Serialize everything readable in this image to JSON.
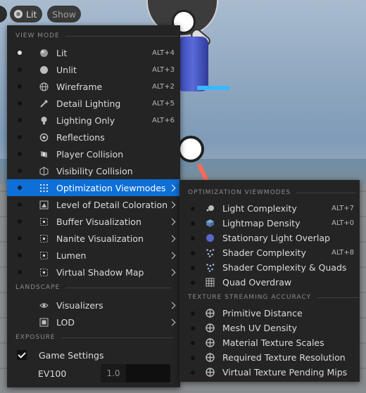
{
  "toolbar": {
    "lit_label": "Lit",
    "show_label": "Show"
  },
  "main_menu": {
    "sections": {
      "view_mode": "VIEW MODE",
      "landscape": "LANDSCAPE",
      "exposure": "EXPOSURE"
    },
    "items": [
      {
        "label": "Lit",
        "shortcut": "ALT+4",
        "icon": "lit-sphere-icon",
        "selected": true
      },
      {
        "label": "Unlit",
        "shortcut": "ALT+3",
        "icon": "unlit-sphere-icon"
      },
      {
        "label": "Wireframe",
        "shortcut": "ALT+2",
        "icon": "wireframe-globe-icon"
      },
      {
        "label": "Detail Lighting",
        "shortcut": "ALT+5",
        "icon": "detail-lighting-icon"
      },
      {
        "label": "Lighting Only",
        "shortcut": "ALT+6",
        "icon": "light-bulb-icon"
      },
      {
        "label": "Reflections",
        "shortcut": "",
        "icon": "reflection-sphere-icon"
      },
      {
        "label": "Player Collision",
        "shortcut": "",
        "icon": "player-collision-icon"
      },
      {
        "label": "Visibility Collision",
        "shortcut": "",
        "icon": "visibility-collision-icon"
      },
      {
        "label": "Optimization Viewmodes",
        "submenu": true,
        "icon": "grid-dots-icon",
        "highlighted": true
      },
      {
        "label": "Level of Detail Coloration",
        "submenu": true,
        "icon": "lod-coloration-icon"
      },
      {
        "label": "Buffer Visualization",
        "submenu": true,
        "icon": "buffer-grid-icon"
      },
      {
        "label": "Nanite Visualization",
        "submenu": true,
        "icon": "nanite-grid-icon"
      },
      {
        "label": "Lumen",
        "submenu": true,
        "icon": "lumen-grid-icon"
      },
      {
        "label": "Virtual Shadow Map",
        "submenu": true,
        "icon": "shadow-map-grid-icon"
      }
    ],
    "landscape_items": [
      {
        "label": "Visualizers",
        "submenu": true,
        "icon": "eye-icon"
      },
      {
        "label": "LOD",
        "submenu": true,
        "icon": "lod-icon"
      }
    ],
    "exposure": {
      "game_settings_label": "Game Settings",
      "game_settings_checked": true,
      "ev100_label": "EV100",
      "ev100_value": "1.0"
    }
  },
  "sub_menu": {
    "sections": {
      "optimization": "OPTIMIZATION VIEWMODES",
      "texture": "TEXTURE STREAMING ACCURACY"
    },
    "items": [
      {
        "label": "Light Complexity",
        "shortcut": "ALT+7",
        "icon": "light-complexity-icon"
      },
      {
        "label": "Lightmap Density",
        "shortcut": "ALT+0",
        "icon": "lightmap-cube-icon"
      },
      {
        "label": "Stationary Light Overlap",
        "shortcut": "",
        "icon": "blue-sphere-icon"
      },
      {
        "label": "Shader Complexity",
        "shortcut": "ALT+8",
        "icon": "shader-dots-icon"
      },
      {
        "label": "Shader Complexity & Quads",
        "shortcut": "",
        "icon": "shader-quads-icon"
      },
      {
        "label": "Quad Overdraw",
        "shortcut": "",
        "icon": "quad-grid-icon"
      }
    ],
    "texture_items": [
      {
        "label": "Primitive Distance",
        "icon": "crosshair-icon"
      },
      {
        "label": "Mesh UV Density",
        "icon": "crosshair-icon"
      },
      {
        "label": "Material Texture Scales",
        "icon": "crosshair-icon"
      },
      {
        "label": "Required Texture Resolution",
        "icon": "crosshair-icon"
      },
      {
        "label": "Virtual Texture Pending Mips",
        "icon": "crosshair-icon"
      }
    ]
  },
  "colors": {
    "highlight": "#0e6fd6",
    "menu_bg": "#242424"
  }
}
